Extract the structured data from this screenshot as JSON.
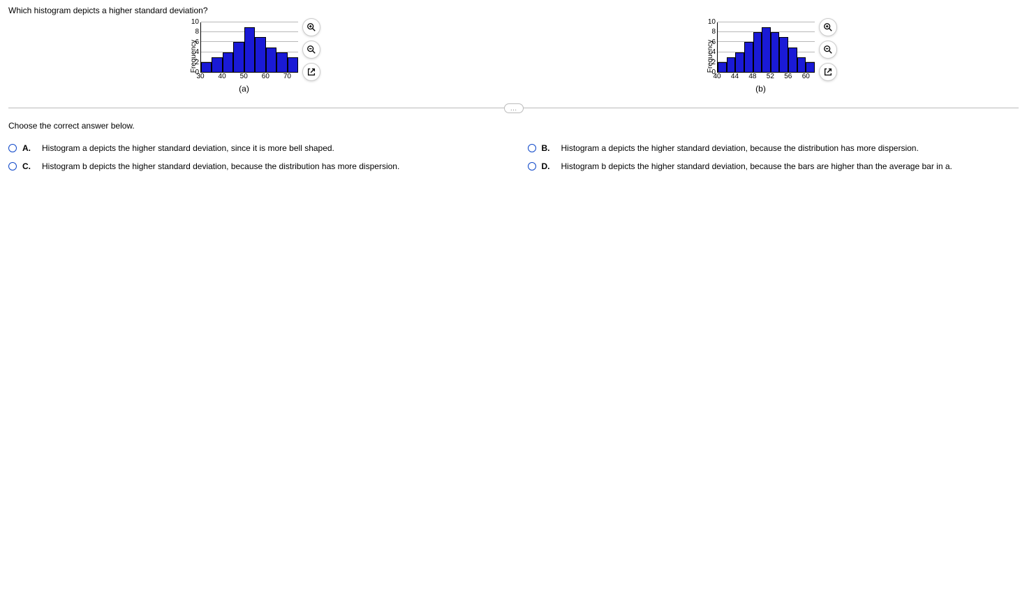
{
  "question": "Which histogram depicts a higher standard deviation?",
  "prompt": "Choose the correct answer below.",
  "divider_label": "…",
  "charts": {
    "a": {
      "ylabel": "Frequency",
      "yticks": [
        "10",
        "8",
        "6",
        "4",
        "2",
        "0"
      ],
      "xticks": [
        "30",
        "40",
        "50",
        "60",
        "70"
      ],
      "label": "(a)"
    },
    "b": {
      "ylabel": "Frequency",
      "yticks": [
        "10",
        "8",
        "6",
        "4",
        "2",
        "0"
      ],
      "xticks": [
        "40",
        "44",
        "48",
        "52",
        "56",
        "60"
      ],
      "label": "(b)"
    }
  },
  "answers": {
    "A": {
      "letter": "A.",
      "text": "Histogram a depicts the higher standard deviation, since it is more bell shaped."
    },
    "B": {
      "letter": "B.",
      "text": "Histogram a depicts the higher standard deviation, because the distribution has more dispersion."
    },
    "C": {
      "letter": "C.",
      "text": "Histogram b depicts the higher standard deviation, because the distribution has more dispersion."
    },
    "D": {
      "letter": "D.",
      "text": "Histogram b depicts the higher standard deviation, because the bars are higher than the average bar in a."
    }
  },
  "chart_data": [
    {
      "type": "bar",
      "title": "(a)",
      "ylabel": "Frequency",
      "xlabel": "",
      "ylim": [
        0,
        10
      ],
      "xlim": [
        30,
        75
      ],
      "categories": [
        30,
        35,
        40,
        45,
        50,
        55,
        60,
        65,
        70
      ],
      "values": [
        2,
        3,
        4,
        6,
        9,
        7,
        5,
        4,
        3
      ]
    },
    {
      "type": "bar",
      "title": "(b)",
      "ylabel": "Frequency",
      "xlabel": "",
      "ylim": [
        0,
        10
      ],
      "xlim": [
        40,
        62
      ],
      "categories": [
        40,
        42,
        44,
        46,
        48,
        50,
        52,
        54,
        56,
        58,
        60
      ],
      "values": [
        2,
        3,
        4,
        6,
        8,
        9,
        8,
        7,
        5,
        3,
        2
      ]
    }
  ]
}
